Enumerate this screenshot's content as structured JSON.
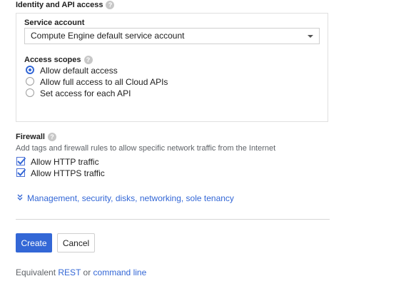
{
  "identity": {
    "title": "Identity and API access",
    "help_glyph": "?",
    "service_account": {
      "label": "Service account",
      "value": "Compute Engine default service account"
    },
    "access_scopes": {
      "label": "Access scopes",
      "options": [
        {
          "label": "Allow default access",
          "selected": true
        },
        {
          "label": "Allow full access to all Cloud APIs",
          "selected": false
        },
        {
          "label": "Set access for each API",
          "selected": false
        }
      ]
    }
  },
  "firewall": {
    "title": "Firewall",
    "description": "Add tags and firewall rules to allow specific network traffic from the Internet",
    "options": [
      {
        "label": "Allow HTTP traffic",
        "checked": true
      },
      {
        "label": "Allow HTTPS traffic",
        "checked": true
      }
    ]
  },
  "more_options": {
    "label": "Management, security, disks, networking, sole tenancy",
    "icon": "double-chevron-down-icon"
  },
  "actions": {
    "create_label": "Create",
    "cancel_label": "Cancel"
  },
  "footer": {
    "prefix": "Equivalent",
    "rest_link": "REST",
    "or_text": "or",
    "command_line_link": "command line"
  },
  "colors": {
    "accent": "#3367d6",
    "border": "#e0e0e0",
    "muted_text": "#5f6368"
  }
}
